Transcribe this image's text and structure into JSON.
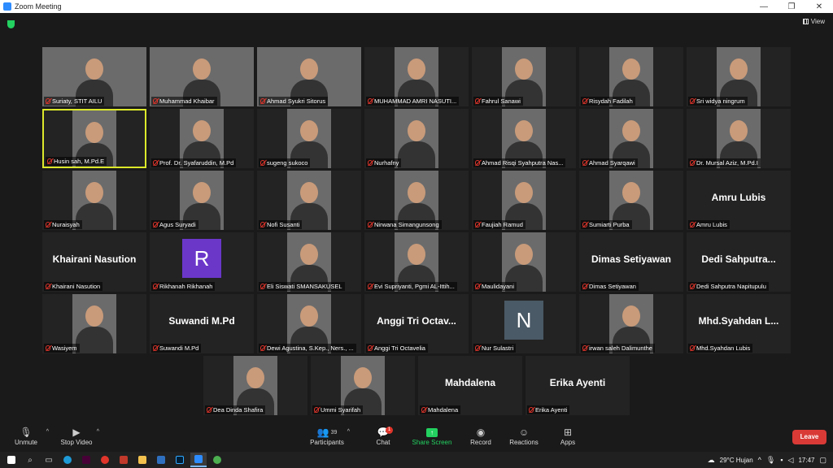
{
  "window": {
    "title": "Zoom Meeting",
    "minimize": "—",
    "maximize": "❐",
    "close": "✕"
  },
  "view_label": "View",
  "participants": [
    {
      "name": "Suriaty, STIT AILU",
      "type": "video"
    },
    {
      "name": "Muhammad Khaibar",
      "type": "video"
    },
    {
      "name": "Ahmad Syukri Sitorus",
      "type": "video"
    },
    {
      "name": "MUHAMMAD AMRI NASUTI...",
      "type": "video"
    },
    {
      "name": "Fahrul Sanawi",
      "type": "video"
    },
    {
      "name": "Risydah Fadilah",
      "type": "video"
    },
    {
      "name": "Sri widya ningrum",
      "type": "video"
    },
    {
      "name": "Husin sah, M.Pd.E",
      "type": "video",
      "active": true
    },
    {
      "name": "Prof. Dr. Syafaruddin, M.Pd",
      "type": "video"
    },
    {
      "name": "sugeng sukoco",
      "type": "video"
    },
    {
      "name": "Nurhafny",
      "type": "video"
    },
    {
      "name": "Ahmad Risqi Syahputra Nas...",
      "type": "video"
    },
    {
      "name": "Ahmad Syarqawi",
      "type": "video"
    },
    {
      "name": "Dr. Mursal Aziz, M.Pd.I",
      "type": "video"
    },
    {
      "name": "Nuraisyah",
      "type": "video"
    },
    {
      "name": "Agus Suryadi",
      "type": "video"
    },
    {
      "name": "Nofi Susanti",
      "type": "video"
    },
    {
      "name": "Nirwana Simangunsong",
      "type": "video"
    },
    {
      "name": "Faujiah Ramud",
      "type": "video"
    },
    {
      "name": "Sumiarti Purba",
      "type": "video"
    },
    {
      "name": "Amru Lubis",
      "type": "name",
      "display": "Amru Lubis"
    },
    {
      "name": "Khairani Nasution",
      "type": "name",
      "display": "Khairani Nasution"
    },
    {
      "name": "Rikhanah Rikhanah",
      "type": "avatar",
      "letter": "R",
      "color": "#6a37c9"
    },
    {
      "name": "Eli Siswati SMANSAKUSEL",
      "type": "video"
    },
    {
      "name": "Evi Supriyanti, Pgmi AL-Ittih...",
      "type": "video"
    },
    {
      "name": "Maulidayani",
      "type": "video"
    },
    {
      "name": "Dimas Setiyawan",
      "type": "name",
      "display": "Dimas Setiyawan"
    },
    {
      "name": "Dedi Sahputra Napitupulu",
      "type": "name",
      "display": "Dedi Sahputra..."
    },
    {
      "name": "Wasiyem",
      "type": "video"
    },
    {
      "name": "Suwandi M.Pd",
      "type": "name",
      "display": "Suwandi M.Pd"
    },
    {
      "name": "Dewi Agustina, S.Kep., Ners., ...",
      "type": "video"
    },
    {
      "name": "Anggi Tri Octavelia",
      "type": "name",
      "display": "Anggi Tri Octav..."
    },
    {
      "name": "Nur Sulastri",
      "type": "avatar",
      "letter": "N",
      "color": "#4a5a66"
    },
    {
      "name": "irwan saleh Dalimunthe",
      "type": "video"
    },
    {
      "name": "Mhd.Syahdan Lubis",
      "type": "name",
      "display": "Mhd.Syahdan L..."
    },
    {
      "name": "Dea Dinda Shafira",
      "type": "video"
    },
    {
      "name": "Ummi Syarifah",
      "type": "video"
    },
    {
      "name": "Mahdalena",
      "type": "name",
      "display": "Mahdalena"
    },
    {
      "name": "Erika Ayenti",
      "type": "name",
      "display": "Erika Ayenti"
    }
  ],
  "controls": {
    "unmute": "Unmute",
    "stop_video": "Stop Video",
    "participants": "Participants",
    "participants_count": "39",
    "chat": "Chat",
    "chat_badge": "1",
    "share_screen": "Share Screen",
    "record": "Record",
    "reactions": "Reactions",
    "apps": "Apps",
    "leave": "Leave"
  },
  "taskbar": {
    "weather": "29°C  Hujan",
    "time": "17:47"
  },
  "colors": {
    "active_speaker": "#dbe82a",
    "leave": "#d93a36",
    "share": "#23d160"
  }
}
